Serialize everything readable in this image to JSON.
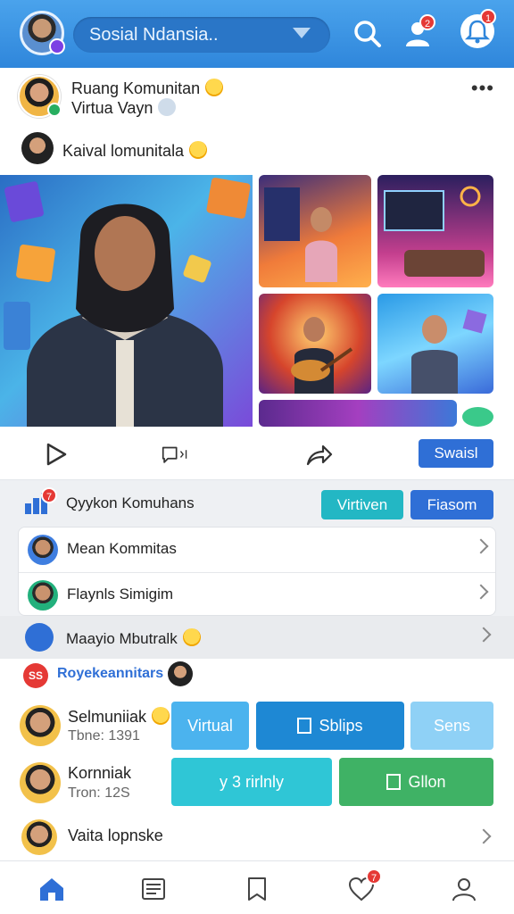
{
  "header": {
    "search_text": "Sosial Ndansia..",
    "profile_badge": "2",
    "notif_badge": "1"
  },
  "post": {
    "title": "Ruang Komunitan",
    "subtitle": "Virtua Vayn",
    "comment_author_text": "Kaival lomunitala"
  },
  "actions": {
    "share_label": "Swaisl"
  },
  "community": {
    "title": "Qyykon Komuhans",
    "badge": "7",
    "btn1": "Virtiven",
    "btn2": "Fiasom",
    "rows": [
      {
        "label": "Mean Kommitas"
      },
      {
        "label": "Flaynls Simigim"
      }
    ],
    "row3_label": "Maayio Mbutralk"
  },
  "friends": {
    "badge": "SS",
    "title": "Royekeannitars",
    "items": [
      {
        "name": "Selmuniiak",
        "meta": "Tbne: 1391"
      },
      {
        "name": "Kornniak",
        "meta": "Tron: 12S"
      },
      {
        "name": "Vaita lopnske"
      }
    ],
    "tags": {
      "t1": "Virtual",
      "t2": "Sblips",
      "t3": "Sens",
      "t4": "y 3  rirlnly",
      "t5": "Gllon"
    }
  },
  "bottom_nav": {
    "likes_badge": "7"
  },
  "colors": {
    "topbar": "#2f86db",
    "primary": "#2f6fd6",
    "teal": "#23b7c4",
    "green": "#3fb265",
    "badge": "#e53935"
  },
  "icons": [
    "search-icon",
    "add-user-icon",
    "bell-icon",
    "play-icon",
    "comment-icon",
    "share-icon",
    "home-icon",
    "news-icon",
    "bookmark-icon",
    "heart-icon",
    "profile-icon",
    "chevron-right-icon"
  ]
}
